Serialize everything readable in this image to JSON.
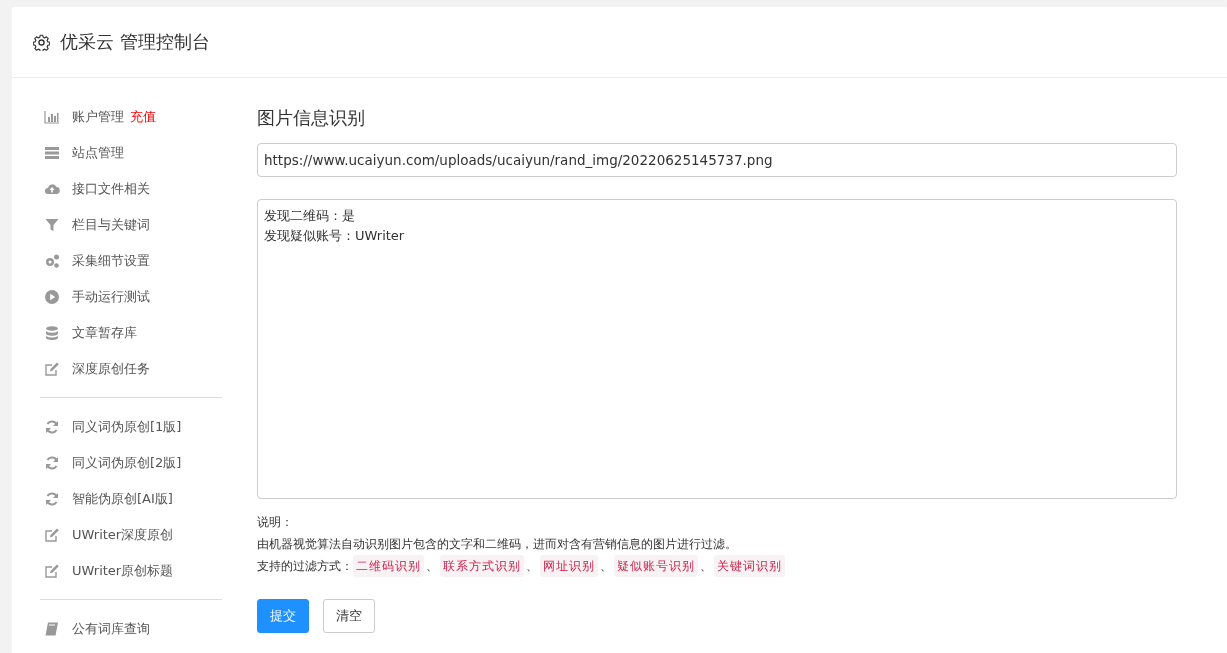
{
  "header": {
    "title": "优采云 管理控制台"
  },
  "sidebar": {
    "groups": [
      {
        "items": [
          {
            "label": "账户管理",
            "badge": "充值"
          },
          {
            "label": "站点管理"
          },
          {
            "label": "接口文件相关"
          },
          {
            "label": "栏目与关键词"
          },
          {
            "label": "采集细节设置"
          },
          {
            "label": "手动运行测试"
          },
          {
            "label": "文章暂存库"
          },
          {
            "label": "深度原创任务"
          }
        ]
      },
      {
        "items": [
          {
            "label": "同义词伪原创[1版]"
          },
          {
            "label": "同义词伪原创[2版]"
          },
          {
            "label": "智能伪原创[AI版]"
          },
          {
            "label": "UWriter深度原创"
          },
          {
            "label": "UWriter原创标题"
          }
        ]
      },
      {
        "items": [
          {
            "label": "公有词库查询"
          }
        ]
      }
    ]
  },
  "main": {
    "title": "图片信息识别",
    "url_field": {
      "value": "https://www.ucaiyun.com/uploads/ucaiyun/rand_img/20220625145737.png"
    },
    "result_field": {
      "lines": [
        "发现二维码：是",
        "发现疑似账号：UWriter"
      ]
    },
    "notes": {
      "heading": "说明：",
      "description": "由机器视觉算法自动识别图片包含的文字和二维码，进而对含有营销信息的图片进行过滤。",
      "methods_label": "支持的过滤方式：",
      "separator": "、",
      "methods": [
        "二维码识别",
        "联系方式识别",
        "网址识别",
        "疑似账号识别",
        "关键词识别"
      ]
    },
    "buttons": [
      {
        "label": "提交",
        "kind": "primary"
      },
      {
        "label": "清空",
        "kind": "default"
      }
    ]
  }
}
